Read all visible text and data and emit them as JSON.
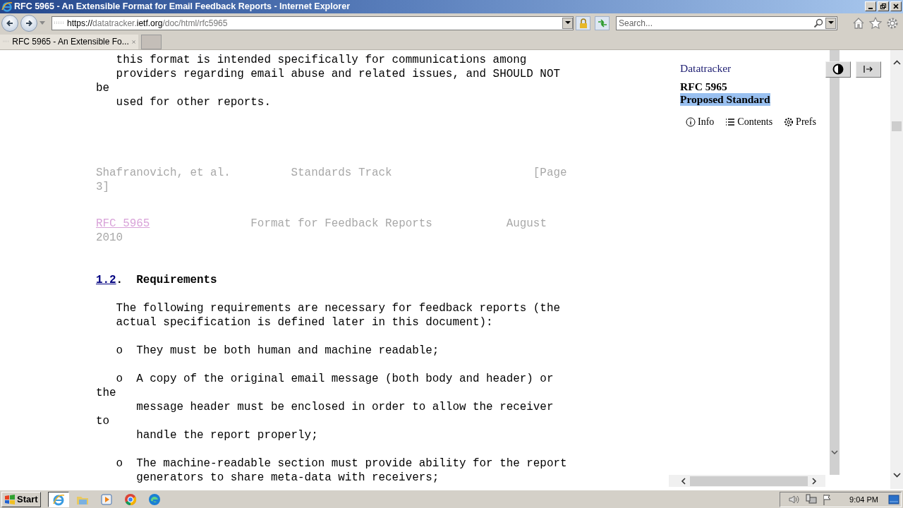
{
  "window": {
    "title": "RFC 5965 - An Extensible Format for Email Feedback Reports - Internet Explorer"
  },
  "toolbar": {
    "address": [
      {
        "text": "https://",
        "emphasis": true
      },
      {
        "text": "datatracker.",
        "emphasis": false
      },
      {
        "text": "ietf.org",
        "emphasis": true
      },
      {
        "text": "/doc/html/rfc5965",
        "emphasis": false
      }
    ],
    "search_placeholder": "Search..."
  },
  "tabs": [
    {
      "label": "RFC 5965 - An Extensible Fo...",
      "selected": true
    }
  ],
  "document": {
    "blocks": [
      {
        "kind": "paragraph",
        "lines": [
          "   this format is intended specifically for communications among",
          "   providers regarding email abuse and related issues, and SHOULD NOT",
          "be",
          "   used for other reports."
        ]
      },
      {
        "kind": "page_footer",
        "lines": [
          "Shafranovich, et al.         Standards Track                     [Page",
          "3]"
        ]
      },
      {
        "kind": "page_header",
        "link": "RFC 5965",
        "lines": [
          "               Format for Feedback Reports           August",
          "2010"
        ]
      },
      {
        "kind": "heading",
        "number": "1.2",
        "title": ".  Requirements"
      },
      {
        "kind": "paragraph",
        "lines": [
          "   The following requirements are necessary for feedback reports (the",
          "   actual specification is defined later in this document):"
        ]
      },
      {
        "kind": "paragraph",
        "lines": [
          "   o  They must be both human and machine readable;"
        ]
      },
      {
        "kind": "paragraph",
        "lines": [
          "   o  A copy of the original email message (both body and header) or",
          "the",
          "      message header must be enclosed in order to allow the receiver",
          "to",
          "      handle the report properly;"
        ]
      },
      {
        "kind": "paragraph",
        "lines": [
          "   o  The machine-readable section must provide ability for the report",
          "      generators to share meta-data with receivers;"
        ]
      }
    ]
  },
  "sidebar": {
    "brand": "Datatracker",
    "rfc": "RFC 5965",
    "status": "Proposed Standard",
    "status_highlighted": true,
    "tabs": [
      {
        "label": "Info",
        "kind": "info"
      },
      {
        "label": "Contents",
        "kind": "contents"
      },
      {
        "label": "Prefs",
        "kind": "prefs"
      }
    ]
  },
  "taskbar": {
    "start": "Start",
    "apps": [
      {
        "kind": "ie",
        "active": true
      },
      {
        "kind": "folder",
        "active": false
      },
      {
        "kind": "media",
        "active": false
      },
      {
        "kind": "chrome",
        "active": false
      },
      {
        "kind": "edge",
        "active": false
      }
    ],
    "clock": "9:04 PM"
  }
}
